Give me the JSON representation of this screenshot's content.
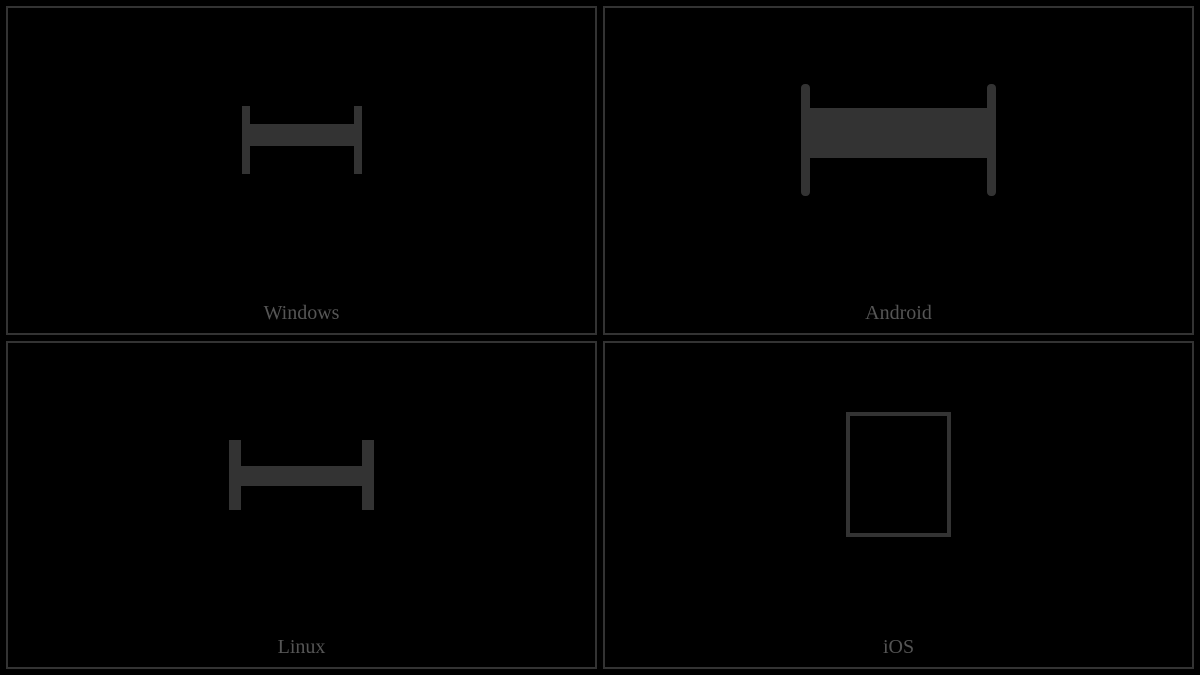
{
  "cells": {
    "windows": {
      "label": "Windows",
      "glyph_type": "h-bar"
    },
    "android": {
      "label": "Android",
      "glyph_type": "h-bar-large"
    },
    "linux": {
      "label": "Linux",
      "glyph_type": "h-bar"
    },
    "ios": {
      "label": "iOS",
      "glyph_type": "missing-box"
    }
  },
  "colors": {
    "background": "#000000",
    "border": "#333333",
    "glyph": "#333333",
    "label": "#555555"
  }
}
